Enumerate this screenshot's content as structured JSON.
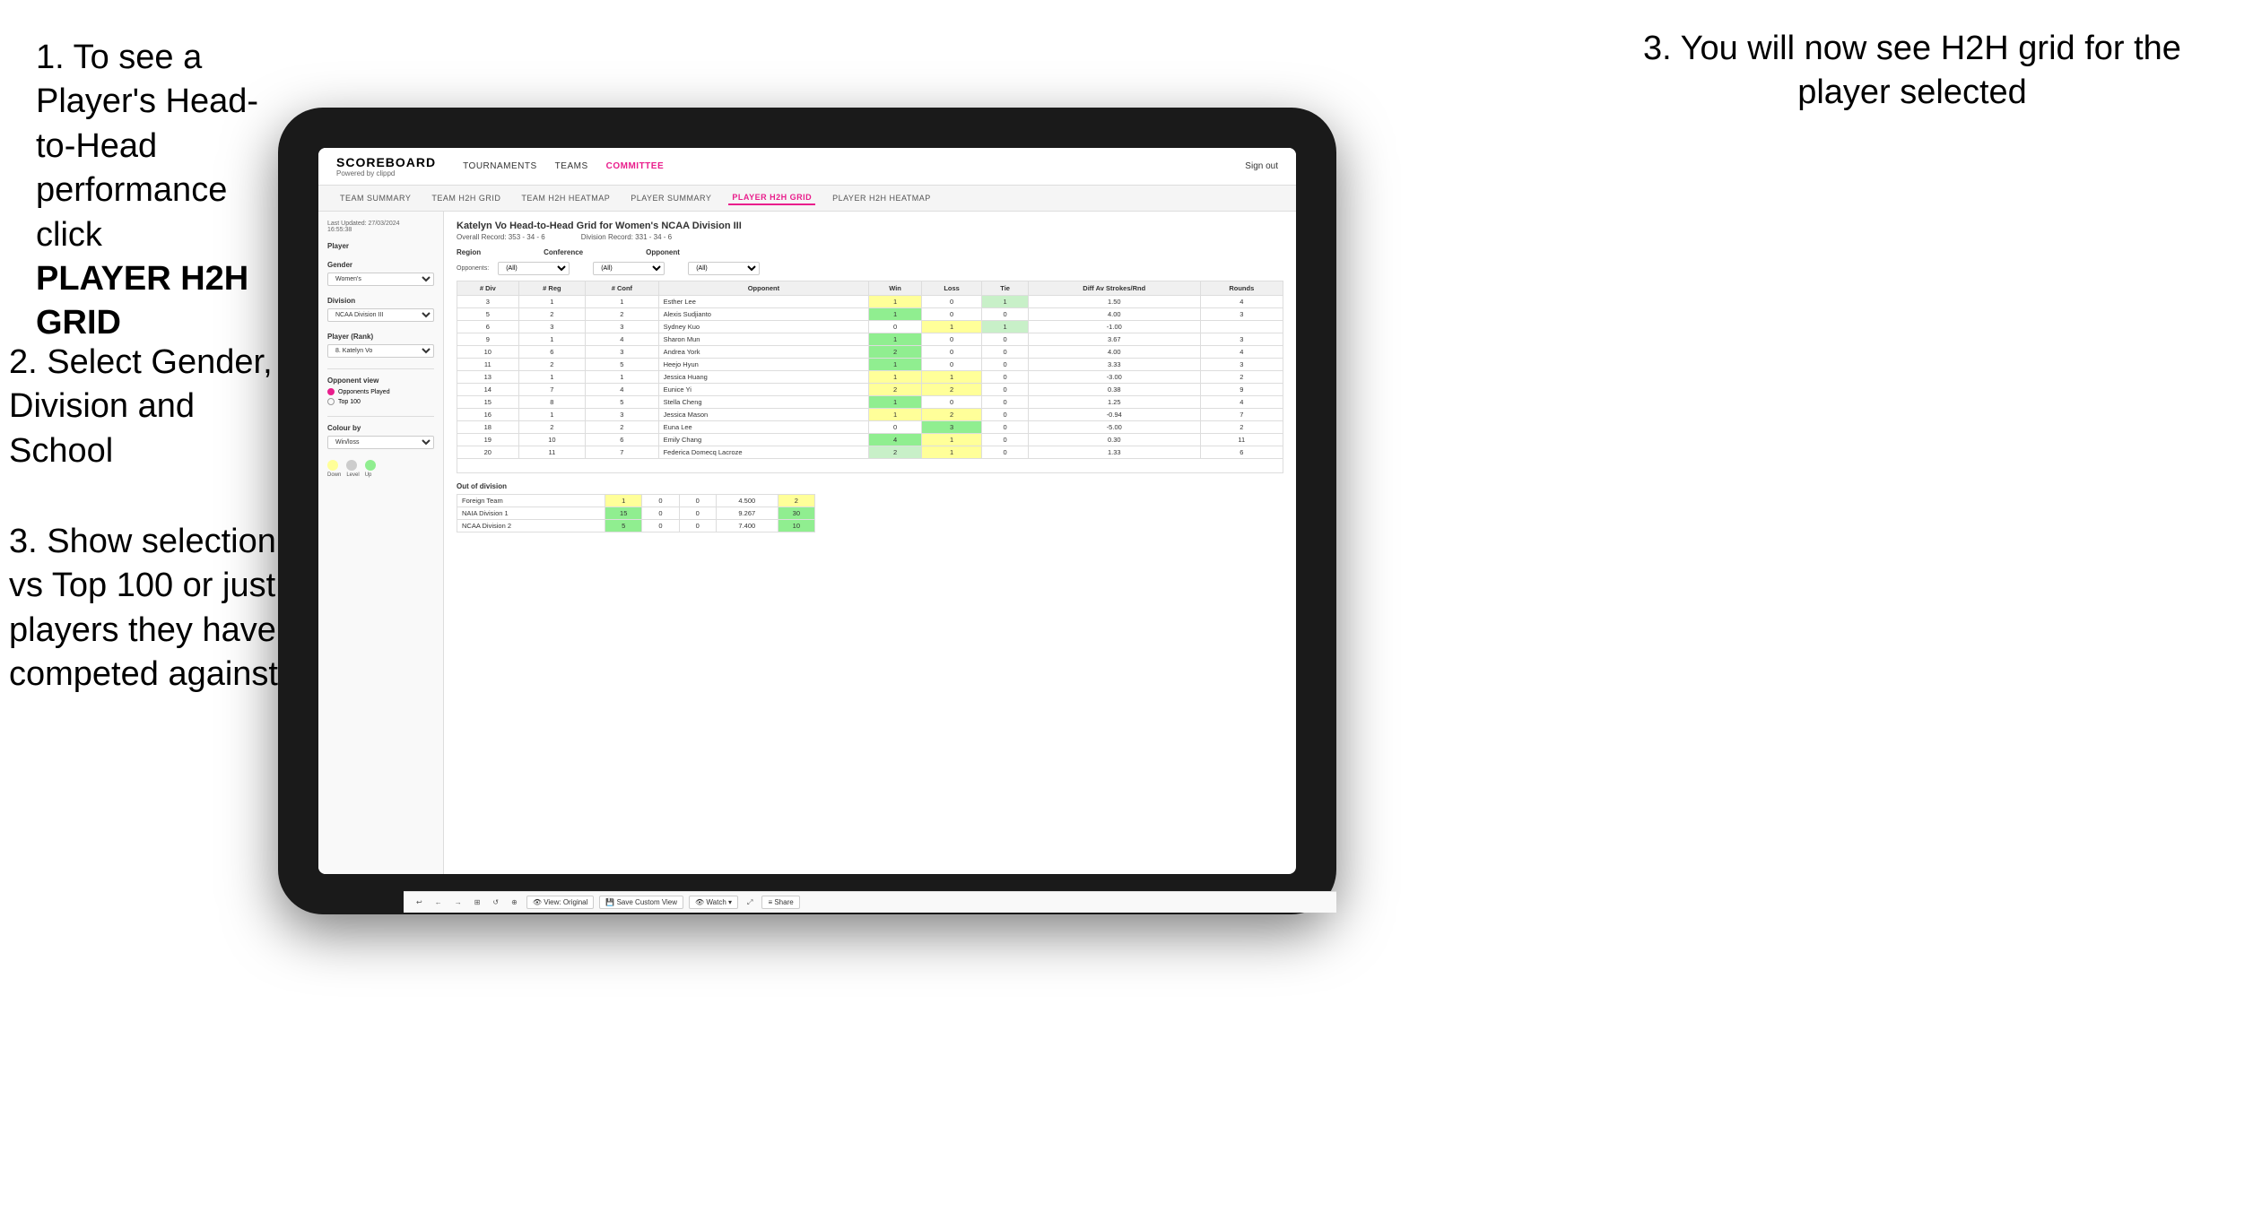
{
  "instructions": {
    "step1": {
      "text": "1. To see a Player's Head-to-Head performance click",
      "bold": "PLAYER H2H GRID"
    },
    "step2": {
      "text": "2. Select Gender, Division and School"
    },
    "step3_bottom": {
      "text": "3. Show selection vs Top 100 or just players they have competed against"
    },
    "step3_top": {
      "text": "3. You will now see H2H grid for the player selected"
    }
  },
  "navbar": {
    "logo": "SCOREBOARD",
    "logo_sub": "Powered by clippd",
    "nav_items": [
      "TOURNAMENTS",
      "TEAMS",
      "COMMITTEE"
    ],
    "active_nav": "COMMITTEE",
    "right_links": [
      "Sign out"
    ]
  },
  "subnav": {
    "items": [
      "TEAM SUMMARY",
      "TEAM H2H GRID",
      "TEAM H2H HEATMAP",
      "PLAYER SUMMARY",
      "PLAYER H2H GRID",
      "PLAYER H2H HEATMAP"
    ],
    "active": "PLAYER H2H GRID"
  },
  "left_panel": {
    "timestamp": "Last Updated: 27/03/2024",
    "timestamp2": "16:55:38",
    "player_label": "Player",
    "gender_label": "Gender",
    "gender_value": "Women's",
    "division_label": "Division",
    "division_value": "NCAA Division III",
    "player_rank_label": "Player (Rank)",
    "player_rank_value": "8. Katelyn Vo",
    "opponent_view_label": "Opponent view",
    "opponent_view_options": [
      "Opponents Played",
      "Top 100"
    ],
    "opponent_view_selected": "Opponents Played",
    "colour_by_label": "Colour by",
    "colour_by_value": "Win/loss",
    "legend_labels": [
      "Down",
      "Level",
      "Up"
    ]
  },
  "grid": {
    "title": "Katelyn Vo Head-to-Head Grid for Women's NCAA Division III",
    "overall_record": "Overall Record: 353 - 34 - 6",
    "division_record": "Division Record: 331 - 34 - 6",
    "region_label": "Region",
    "conference_label": "Conference",
    "opponent_label": "Opponent",
    "opponents_label": "Opponents:",
    "filter_all": "(All)",
    "columns": [
      "# Div",
      "# Reg",
      "# Conf",
      "Opponent",
      "Win",
      "Loss",
      "Tie",
      "Diff Av Strokes/Rnd",
      "Rounds"
    ],
    "rows": [
      {
        "div": "3",
        "reg": "1",
        "conf": "1",
        "opponent": "Esther Lee",
        "win": 1,
        "loss": 0,
        "tie": 1,
        "diff": 1.5,
        "rounds": 4,
        "win_color": "yellow",
        "loss_color": "white",
        "tie_color": "light-green"
      },
      {
        "div": "5",
        "reg": "2",
        "conf": "2",
        "opponent": "Alexis Sudjianto",
        "win": 1,
        "loss": 0,
        "tie": 0,
        "diff": 4.0,
        "rounds": 3,
        "win_color": "green",
        "loss_color": "white",
        "tie_color": "white"
      },
      {
        "div": "6",
        "reg": "3",
        "conf": "3",
        "opponent": "Sydney Kuo",
        "win": 0,
        "loss": 1,
        "tie": 1,
        "diff": -1.0,
        "rounds": "",
        "win_color": "white",
        "loss_color": "yellow",
        "tie_color": "light-green"
      },
      {
        "div": "9",
        "reg": "1",
        "conf": "4",
        "opponent": "Sharon Mun",
        "win": 1,
        "loss": 0,
        "tie": 0,
        "diff": 3.67,
        "rounds": 3,
        "win_color": "green",
        "loss_color": "white",
        "tie_color": "white"
      },
      {
        "div": "10",
        "reg": "6",
        "conf": "3",
        "opponent": "Andrea York",
        "win": 2,
        "loss": 0,
        "tie": 0,
        "diff": 4.0,
        "rounds": 4,
        "win_color": "green",
        "loss_color": "white",
        "tie_color": "white"
      },
      {
        "div": "11",
        "reg": "2",
        "conf": "5",
        "opponent": "Heejo Hyun",
        "win": 1,
        "loss": 0,
        "tie": 0,
        "diff": 3.33,
        "rounds": 3,
        "win_color": "green",
        "loss_color": "white",
        "tie_color": "white"
      },
      {
        "div": "13",
        "reg": "1",
        "conf": "1",
        "opponent": "Jessica Huang",
        "win": 1,
        "loss": 1,
        "tie": 0,
        "diff": -3.0,
        "rounds": 2,
        "win_color": "yellow",
        "loss_color": "yellow",
        "tie_color": "white"
      },
      {
        "div": "14",
        "reg": "7",
        "conf": "4",
        "opponent": "Eunice Yi",
        "win": 2,
        "loss": 2,
        "tie": 0,
        "diff": 0.38,
        "rounds": 9,
        "win_color": "yellow",
        "loss_color": "yellow",
        "tie_color": "white"
      },
      {
        "div": "15",
        "reg": "8",
        "conf": "5",
        "opponent": "Stella Cheng",
        "win": 1,
        "loss": 0,
        "tie": 0,
        "diff": 1.25,
        "rounds": 4,
        "win_color": "green",
        "loss_color": "white",
        "tie_color": "white"
      },
      {
        "div": "16",
        "reg": "1",
        "conf": "3",
        "opponent": "Jessica Mason",
        "win": 1,
        "loss": 2,
        "tie": 0,
        "diff": -0.94,
        "rounds": 7,
        "win_color": "yellow",
        "loss_color": "yellow",
        "tie_color": "white"
      },
      {
        "div": "18",
        "reg": "2",
        "conf": "2",
        "opponent": "Euna Lee",
        "win": 0,
        "loss": 3,
        "tie": 0,
        "diff": -5.0,
        "rounds": 2,
        "win_color": "white",
        "loss_color": "green",
        "tie_color": "white"
      },
      {
        "div": "19",
        "reg": "10",
        "conf": "6",
        "opponent": "Emily Chang",
        "win": 4,
        "loss": 1,
        "tie": 0,
        "diff": 0.3,
        "rounds": 11,
        "win_color": "green",
        "loss_color": "yellow",
        "tie_color": "white"
      },
      {
        "div": "20",
        "reg": "11",
        "conf": "7",
        "opponent": "Federica Domecq Lacroze",
        "win": 2,
        "loss": 1,
        "tie": 0,
        "diff": 1.33,
        "rounds": 6,
        "win_color": "light-green",
        "loss_color": "yellow",
        "tie_color": "white"
      }
    ],
    "out_of_division_label": "Out of division",
    "out_of_division_rows": [
      {
        "opponent": "Foreign Team",
        "win": 1,
        "loss": 0,
        "tie": 0,
        "diff": 4.5,
        "rounds": 2
      },
      {
        "opponent": "NAIA Division 1",
        "win": 15,
        "loss": 0,
        "tie": 0,
        "diff": 9.267,
        "rounds": 30
      },
      {
        "opponent": "NCAA Division 2",
        "win": 5,
        "loss": 0,
        "tie": 0,
        "diff": 7.4,
        "rounds": 10
      }
    ]
  },
  "toolbar": {
    "buttons": [
      "↩",
      "←",
      "→",
      "⊞",
      "↺",
      "⊕",
      "👁 View: Original",
      "💾 Save Custom View",
      "👁 Watch ▾",
      "⤢",
      "≡ Share"
    ]
  },
  "colors": {
    "accent": "#e91e8c",
    "green": "#90ee90",
    "yellow": "#ffff99",
    "light_green": "#c8f0c8"
  }
}
